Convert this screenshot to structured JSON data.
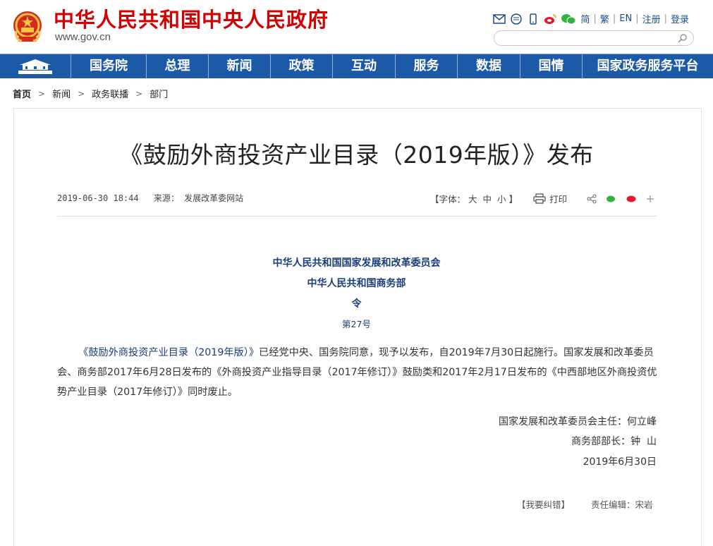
{
  "header": {
    "site_title": "中华人民共和国中央人民政府",
    "site_url": "www.gov.cn",
    "links": [
      "简",
      "繁",
      "EN",
      "注册",
      "登录"
    ],
    "icons": [
      "mail-icon",
      "chat-icon",
      "mobile-icon",
      "weibo-icon",
      "wechat-icon"
    ],
    "search_placeholder": ""
  },
  "nav": {
    "items": [
      "国务院",
      "总理",
      "新闻",
      "政策",
      "互动",
      "服务",
      "数据",
      "国情",
      "国家政务服务平台"
    ]
  },
  "breadcrumb": {
    "items": [
      "首页",
      "新闻",
      "政务联播",
      "部门"
    ]
  },
  "article": {
    "title": "《鼓励外商投资产业目录（2019年版）》发布",
    "datetime": "2019-06-30 18:44",
    "source_label": "来源：",
    "source": "发展改革委网站",
    "font_label": "【字体：",
    "font_sizes": [
      "大",
      "中",
      "小"
    ],
    "font_close": "】",
    "print_label": "打印",
    "issuer1": "中华人民共和国国家发展和改革委员会",
    "issuer2": "中华人民共和国商务部",
    "order": "令",
    "number": "第27号",
    "para_link": "《鼓励外商投资产业目录（2019年版）》",
    "para_rest": "已经党中央、国务院同意，现予以发布，自2019年7月30日起施行。国家发展和改革委员会、商务部2017年6月28日发布的《外商投资产业指导目录（2017年修订）》鼓励类和2017年2月17日发布的《中西部地区外商投资优势产业目录（2017年修订）》同时废止。",
    "sign1": "国家发展和改革委员会主任：何立峰",
    "sign2": "商务部部长：钟  山",
    "sign3": "2019年6月30日",
    "correction": "【我要纠错】",
    "editor": "责任编辑：宋岩"
  },
  "colors": {
    "brand_red": "#d40000",
    "nav_blue": "#1c59a6",
    "heading_blue": "#1a3d7a"
  }
}
